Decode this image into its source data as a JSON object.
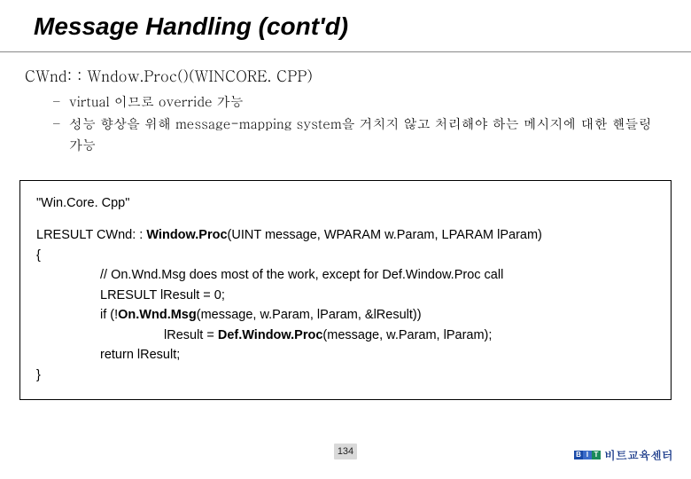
{
  "title": "Message Handling (cont'd)",
  "section_head": "CWnd: : Wndow.Proc()(WINCORE. CPP)",
  "bullets": [
    "virtual 이므로 override 가능",
    "성능 향상을 위해 message-mapping system을 거치지 않고 처리해야 하는 메시지에 대한 핸들링 가능"
  ],
  "code": {
    "file_label": "\"Win.Core. Cpp\"",
    "sig_prefix": "LRESULT CWnd: : ",
    "sig_bold": "Window.Proc",
    "sig_suffix": "(UINT message, WPARAM w.Param, LPARAM lParam)",
    "open_brace": "{",
    "line1": "// On.Wnd.Msg does most of the work, except for Def.Window.Proc call",
    "line2": "LRESULT lResult = 0;",
    "line3a": "if (!",
    "line3b": "On.Wnd.Msg",
    "line3c": "(message, w.Param, lParam, &lResult))",
    "line4a": "lResult = ",
    "line4b": "Def.Window.Proc",
    "line4c": "(message, w.Param, lParam);",
    "line5": "return lResult;",
    "close_brace": "}"
  },
  "page_number": "134",
  "footer": {
    "badge": [
      "B",
      "I",
      "T"
    ],
    "text": "비트교육센터"
  }
}
